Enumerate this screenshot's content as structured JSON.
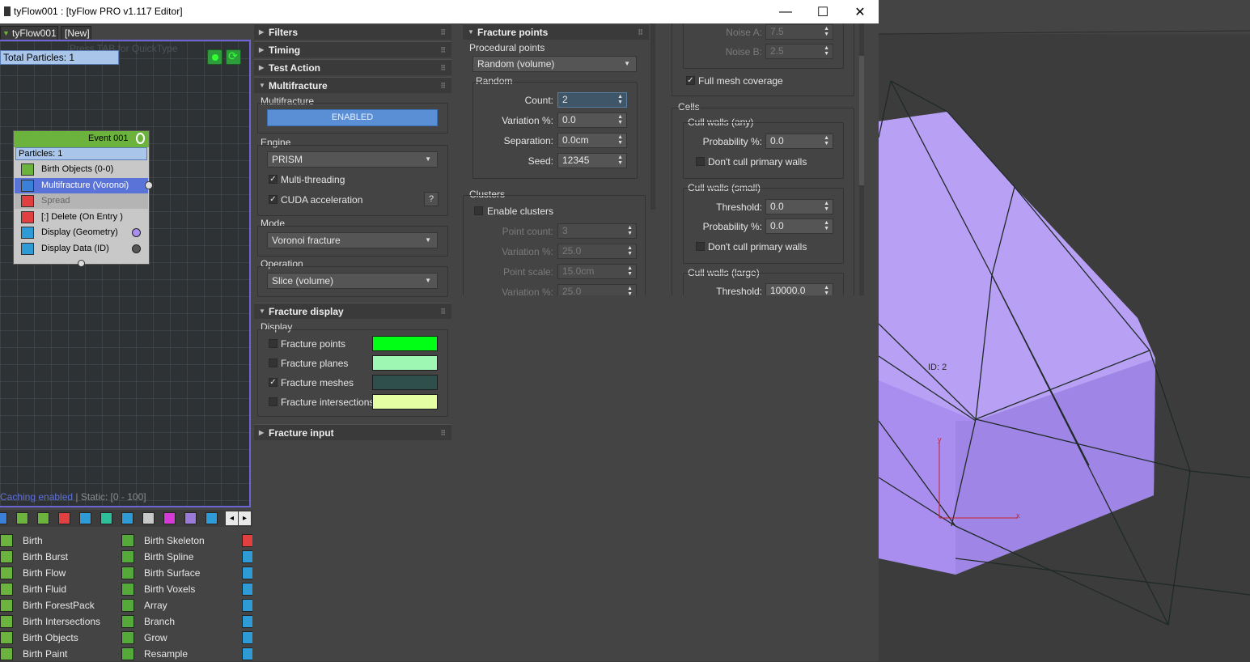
{
  "window": {
    "title": "tyFlow001 : [tyFlow PRO v1.117 Editor]",
    "minimize": "—",
    "maximize": "☐",
    "close": "✕"
  },
  "graph": {
    "tabs": [
      "tyFlow001",
      "[New]"
    ],
    "quicktype_hint": "Press TAB for QuickType",
    "total_particles": "Total Particles: 1",
    "event": {
      "title": "Event  001",
      "particles": "Particles: 1",
      "operators": [
        {
          "label": "Birth Objects (0-0)",
          "color": "#6cb33e"
        },
        {
          "label": "Multifracture (Voronoi)",
          "color": "#3a7fd8",
          "selected": true
        },
        {
          "label": "Spread",
          "color": "#e04040",
          "disabled": true
        },
        {
          "label": "[:] Delete (On Entry )",
          "color": "#e04040"
        },
        {
          "label": "Display (Geometry)",
          "color": "#2e9ad6"
        },
        {
          "label": "Display Data (ID)",
          "color": "#2e9ad6"
        }
      ]
    },
    "status_cache": "Caching enabled",
    "status_static": " | Static: [0 - 100]"
  },
  "operator_list": {
    "col1": [
      "Birth",
      "Birth Burst",
      "Birth Flow",
      "Birth Fluid",
      "Birth ForestPack",
      "Birth Intersections",
      "Birth Objects",
      "Birth Paint"
    ],
    "col2": [
      "Birth Skeleton",
      "Birth Spline",
      "Birth Surface",
      "Birth Voxels",
      "Array",
      "Branch",
      "Grow",
      "Resample"
    ]
  },
  "panel1": {
    "rollouts": [
      "Filters",
      "Timing",
      "Test Action",
      "Multifracture",
      "Fracture display",
      "Fracture input"
    ],
    "multifracture_label": "Multifracture",
    "enabled_button": "ENABLED",
    "engine_label": "Engine",
    "engine_value": "PRISM",
    "multithreading": "Multi-threading",
    "cuda": "CUDA acceleration",
    "help": "?",
    "mode_label": "Mode",
    "mode_value": "Voronoi fracture",
    "operation_label": "Operation",
    "operation_value": "Slice (volume)",
    "display_label": "Display",
    "fracture_points": "Fracture points",
    "fracture_planes": "Fracture planes",
    "fracture_meshes": "Fracture meshes",
    "fracture_intersections": "Fracture intersections",
    "colors": {
      "points": "#00ff14",
      "planes": "#9ff7b4",
      "meshes": "#2f4f4c",
      "intersections": "#e5ffa3"
    }
  },
  "panel2": {
    "rollout": "Fracture points",
    "procedural_label": "Procedural points",
    "procedural_value": "Random (volume)",
    "random_label": "Random",
    "count_label": "Count:",
    "count_value": "2",
    "variation_label": "Variation %:",
    "variation_value": "0.0",
    "separation_label": "Separation:",
    "separation_value": "0.0cm",
    "seed_label": "Seed:",
    "seed_value": "12345",
    "clusters_label": "Clusters",
    "enable_clusters": "Enable clusters",
    "point_count_label": "Point count:",
    "point_count_value": "3",
    "cvariation_label": "Variation %:",
    "cvariation_value": "25.0",
    "point_scale_label": "Point scale:",
    "point_scale_value": "15.0cm",
    "cvariation2_label": "Variation %:",
    "cvariation2_value": "25.0"
  },
  "panel3": {
    "noise_a_label": "Noise A:",
    "noise_a_value": "7.5",
    "noise_b_label": "Noise B:",
    "noise_b_value": "2.5",
    "full_mesh": "Full mesh coverage",
    "cells_label": "Cells",
    "cull_any_label": "Cull walls (any)",
    "prob1_label": "Probability %:",
    "prob1_value": "0.0",
    "dont_cull1": "Don't cull primary walls",
    "cull_small_label": "Cull walls (small)",
    "thresh1_label": "Threshold:",
    "thresh1_value": "0.0",
    "prob2_label": "Probability %:",
    "prob2_value": "0.0",
    "dont_cull2": "Don't cull primary walls",
    "cull_large_label": "Cull walls (large)",
    "thresh2_label": "Threshold:",
    "thresh2_value": "10000.0"
  },
  "viewport": {
    "id_label": "ID: 2",
    "axis_y": "y",
    "axis_x": "x",
    "mesh_color": "#a98ef0"
  }
}
